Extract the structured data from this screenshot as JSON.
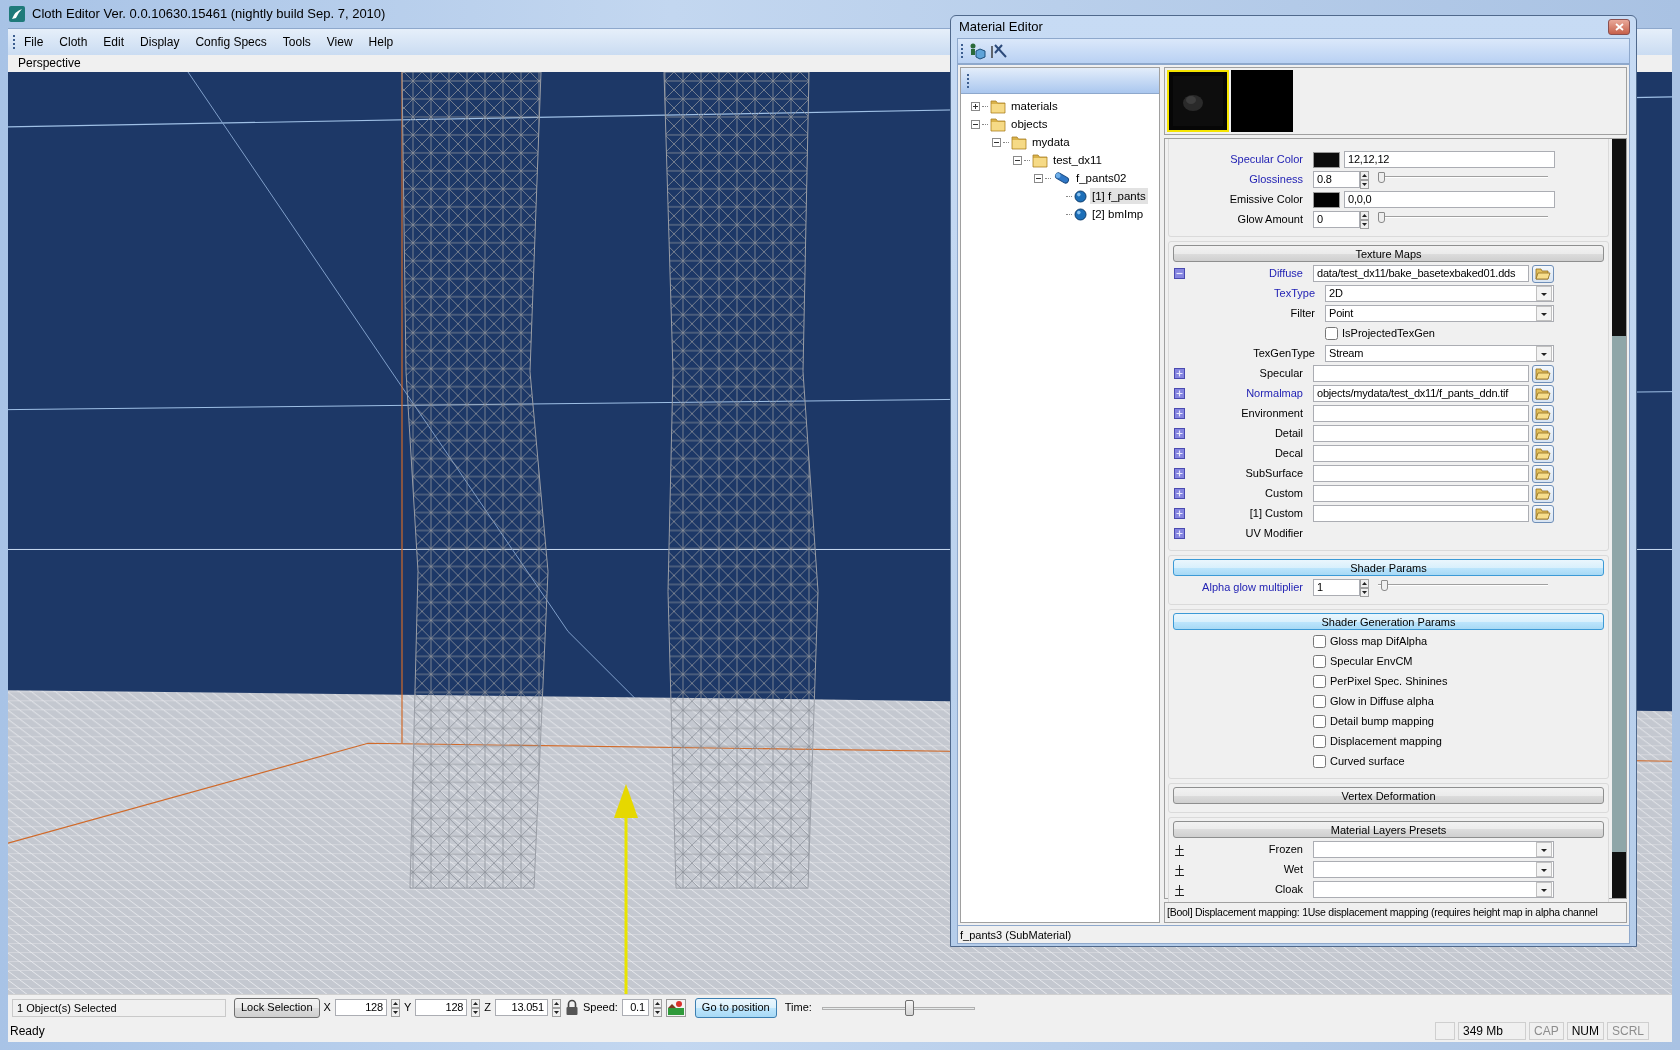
{
  "window": {
    "title": "Cloth Editor Ver. 0.0.10630.15461 (nightly build Sep. 7, 2010)"
  },
  "menu": [
    "File",
    "Cloth",
    "Edit",
    "Display",
    "Config Specs",
    "Tools",
    "View",
    "Help"
  ],
  "viewport": {
    "label": "Perspective",
    "kind": "picture"
  },
  "material_editor": {
    "title": "Material Editor",
    "tree": [
      {
        "label": "materials",
        "kind": "folder",
        "expanded": false,
        "selected": false
      },
      {
        "label": "objects",
        "kind": "folder",
        "expanded": true,
        "selected": false,
        "children": [
          {
            "label": "mydata",
            "kind": "folder",
            "expanded": true,
            "selected": false,
            "children": [
              {
                "label": "test_dx11",
                "kind": "folder",
                "expanded": true,
                "selected": false,
                "children": [
                  {
                    "label": "f_pants02",
                    "kind": "material",
                    "expanded": true,
                    "selected": false,
                    "children": [
                      {
                        "label": "[1] f_pants",
                        "kind": "submaterial",
                        "selected": true
                      },
                      {
                        "label": "[2] bmImp",
                        "kind": "submaterial",
                        "selected": false
                      }
                    ]
                  }
                ]
              }
            ]
          }
        ]
      }
    ],
    "previews": [
      {
        "kind": "picture",
        "selected": true
      },
      {
        "kind": "blank",
        "selected": false
      }
    ],
    "sections": [
      {
        "rows": [
          {
            "kind": "color",
            "label": "Specular Color",
            "highlighted": true,
            "color": "#0c0c0c",
            "value": "12,12,12"
          },
          {
            "kind": "slider",
            "label": "Glossiness",
            "highlighted": true,
            "value": "0.8",
            "level": 0
          },
          {
            "kind": "color",
            "label": "Emissive Color",
            "highlighted": false,
            "color": "#000000",
            "value": "0,0,0"
          },
          {
            "kind": "slider",
            "label": "Glow Amount",
            "highlighted": false,
            "value": "0",
            "level": 0
          }
        ]
      },
      {
        "title": "Texture Maps",
        "active": false,
        "rows": [
          {
            "kind": "file",
            "label": "Diffuse",
            "highlighted": true,
            "expanded": true,
            "value": "data/test_dx11/bake_basetexbaked01.dds",
            "children": [
              {
                "kind": "combo",
                "label": "TexType",
                "highlighted": true,
                "value": "2D"
              },
              {
                "kind": "combo",
                "label": "Filter",
                "highlighted": false,
                "value": "Point"
              },
              {
                "kind": "check",
                "label": "IsProjectedTexGen",
                "checked": false
              },
              {
                "kind": "combo",
                "label": "TexGenType",
                "highlighted": false,
                "value": "Stream"
              }
            ]
          },
          {
            "kind": "file",
            "label": "Specular",
            "highlighted": false,
            "expanded": false
          },
          {
            "kind": "file",
            "label": "Normalmap",
            "highlighted": true,
            "expanded": false,
            "value": "objects/mydata/test_dx11/f_pants_ddn.tif"
          },
          {
            "kind": "file",
            "label": "Environment",
            "highlighted": false,
            "expanded": false
          },
          {
            "kind": "file",
            "label": "Detail",
            "highlighted": false,
            "expanded": false
          },
          {
            "kind": "file",
            "label": "Decal",
            "highlighted": false,
            "expanded": false
          },
          {
            "kind": "file",
            "label": "SubSurface",
            "highlighted": false,
            "expanded": false
          },
          {
            "kind": "file",
            "label": "Custom",
            "highlighted": false,
            "expanded": false
          },
          {
            "kind": "file",
            "label": "[1] Custom",
            "highlighted": false,
            "expanded": false
          },
          {
            "kind": "group",
            "label": "UV Modifier",
            "highlighted": false,
            "expanded": false
          }
        ]
      },
      {
        "title": "Shader Params",
        "active": true,
        "rows": [
          {
            "kind": "slider",
            "label": "Alpha glow multiplier",
            "highlighted": true,
            "value": "1",
            "level": 0.02
          }
        ]
      },
      {
        "title": "Shader Generation Params",
        "active": true,
        "rows": [
          {
            "kind": "check",
            "label": "Gloss map DifAlpha",
            "checked": false
          },
          {
            "kind": "check",
            "label": "Specular EnvCM",
            "checked": false
          },
          {
            "kind": "check",
            "label": "PerPixel Spec. Shinines",
            "checked": false
          },
          {
            "kind": "check",
            "label": "Glow in Diffuse alpha",
            "checked": false
          },
          {
            "kind": "check",
            "label": "Detail bump mapping",
            "checked": false
          },
          {
            "kind": "check",
            "label": "Displacement mapping",
            "checked": false
          },
          {
            "kind": "check",
            "label": "Curved surface",
            "checked": false
          }
        ]
      },
      {
        "title": "Vertex Deformation",
        "active": false
      },
      {
        "title": "Material Layers Presets",
        "active": false,
        "rows": [
          {
            "kind": "preset",
            "label": "Frozen",
            "expanded": false
          },
          {
            "kind": "preset",
            "label": "Wet",
            "expanded": false
          },
          {
            "kind": "preset",
            "label": "Cloak",
            "expanded": false
          }
        ]
      }
    ],
    "info": "[Bool] Displacement mapping: 1Use displacement mapping (requires height map in alpha channel",
    "status": "f_pants3 (SubMaterial)"
  },
  "toolbar": {
    "selection": "1 Object(s) Selected",
    "lock_button": "Lock Selection",
    "coords": [
      {
        "label": "X",
        "value": "128"
      },
      {
        "label": "Y",
        "value": "128"
      },
      {
        "label": "Z",
        "value": "13.051"
      }
    ],
    "speed": {
      "label": "Speed:",
      "value": "0.1"
    },
    "goto_button": "Go to position",
    "time": {
      "label": "Time:",
      "level": 0.575
    }
  },
  "status_bar": {
    "text": "Ready",
    "memory": "349 Mb",
    "indicators": [
      {
        "label": "CAP",
        "on": false
      },
      {
        "label": "NUM",
        "on": true
      },
      {
        "label": "SCRL",
        "on": false
      }
    ]
  }
}
